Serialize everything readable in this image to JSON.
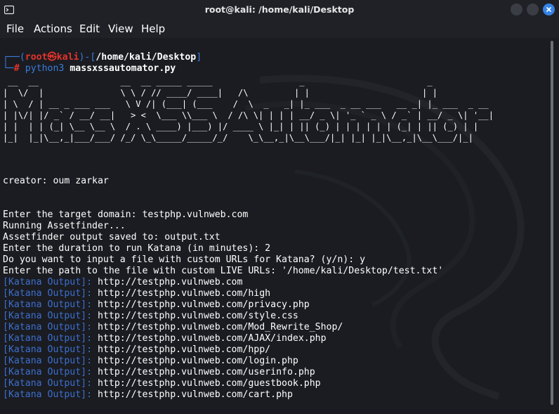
{
  "window": {
    "title": "root@kali: /home/kali/Desktop"
  },
  "menu": {
    "items": [
      "File",
      "Actions",
      "Edit",
      "View",
      "Help"
    ]
  },
  "prompt": {
    "corner_top": "┌──(",
    "user": "root",
    "at_symbol": "㉿",
    "host": "kali",
    "sep": ")-[",
    "path": "/home/kali/Desktop",
    "close": "]",
    "corner_bottom": "└─",
    "hash": "#",
    "cmd": "python3",
    "arg": "massxssautomator.py"
  },
  "banner": [
    " __  __                __  __ _____ _____                 _                        _             ",
    "|  \\/  |               \\ \\ / // ____/ ____|   /\\         | |                      | |            ",
    "| \\  / | __ _ ___ ___   \\ V /| (___| (___    /  \\  _   _| |_ ___  _ __ ___   __ _| |_ ___  _ __ ",
    "| |\\/| |/ _` / __/ __|   > <  \\___ \\\\___ \\  / /\\ \\| | | | __/ _ \\| '_ ` _ \\ / _` | __/ _ \\| '__|",
    "| |  | | (_| \\__ \\__ \\  / . \\ ____) |___) |/ ____ \\ |_| | || (_) | | | | | | (_| | || (_) | |   ",
    "|_|  |_|\\__,_|___/___/ /_/ \\_\\_____/_____/_/    \\_\\__,_|\\__\\___/|_| |_| |_|\\__,_|\\__\\___/|_|   "
  ],
  "output": {
    "creator": "creator: oum zarkar",
    "lines": [
      "Enter the target domain: testphp.vulnweb.com",
      "Running Assetfinder...",
      "Assetfinder output saved to: output.txt",
      "Enter the duration to run Katana (in minutes): 2",
      "Do you want to input a file with custom URLs for Katana? (y/n): y",
      "Enter the path to the file with custom LIVE URLs: '/home/kali/Desktop/test.txt'"
    ],
    "katana_label": "[Katana Output]:",
    "katana_urls": [
      "http://testphp.vulnweb.com",
      "http://testphp.vulnweb.com/high",
      "http://testphp.vulnweb.com/privacy.php",
      "http://testphp.vulnweb.com/style.css",
      "http://testphp.vulnweb.com/Mod_Rewrite_Shop/",
      "http://testphp.vulnweb.com/AJAX/index.php",
      "http://testphp.vulnweb.com/hpp/",
      "http://testphp.vulnweb.com/login.php",
      "http://testphp.vulnweb.com/userinfo.php",
      "http://testphp.vulnweb.com/guestbook.php",
      "http://testphp.vulnweb.com/cart.php"
    ]
  },
  "colors": {
    "background": "#1a1c21",
    "prompt_blue": "#3b7bdc",
    "prompt_red": "#e5332b",
    "katana_blue": "#3d6fcf",
    "close_button": "#3584e4"
  }
}
